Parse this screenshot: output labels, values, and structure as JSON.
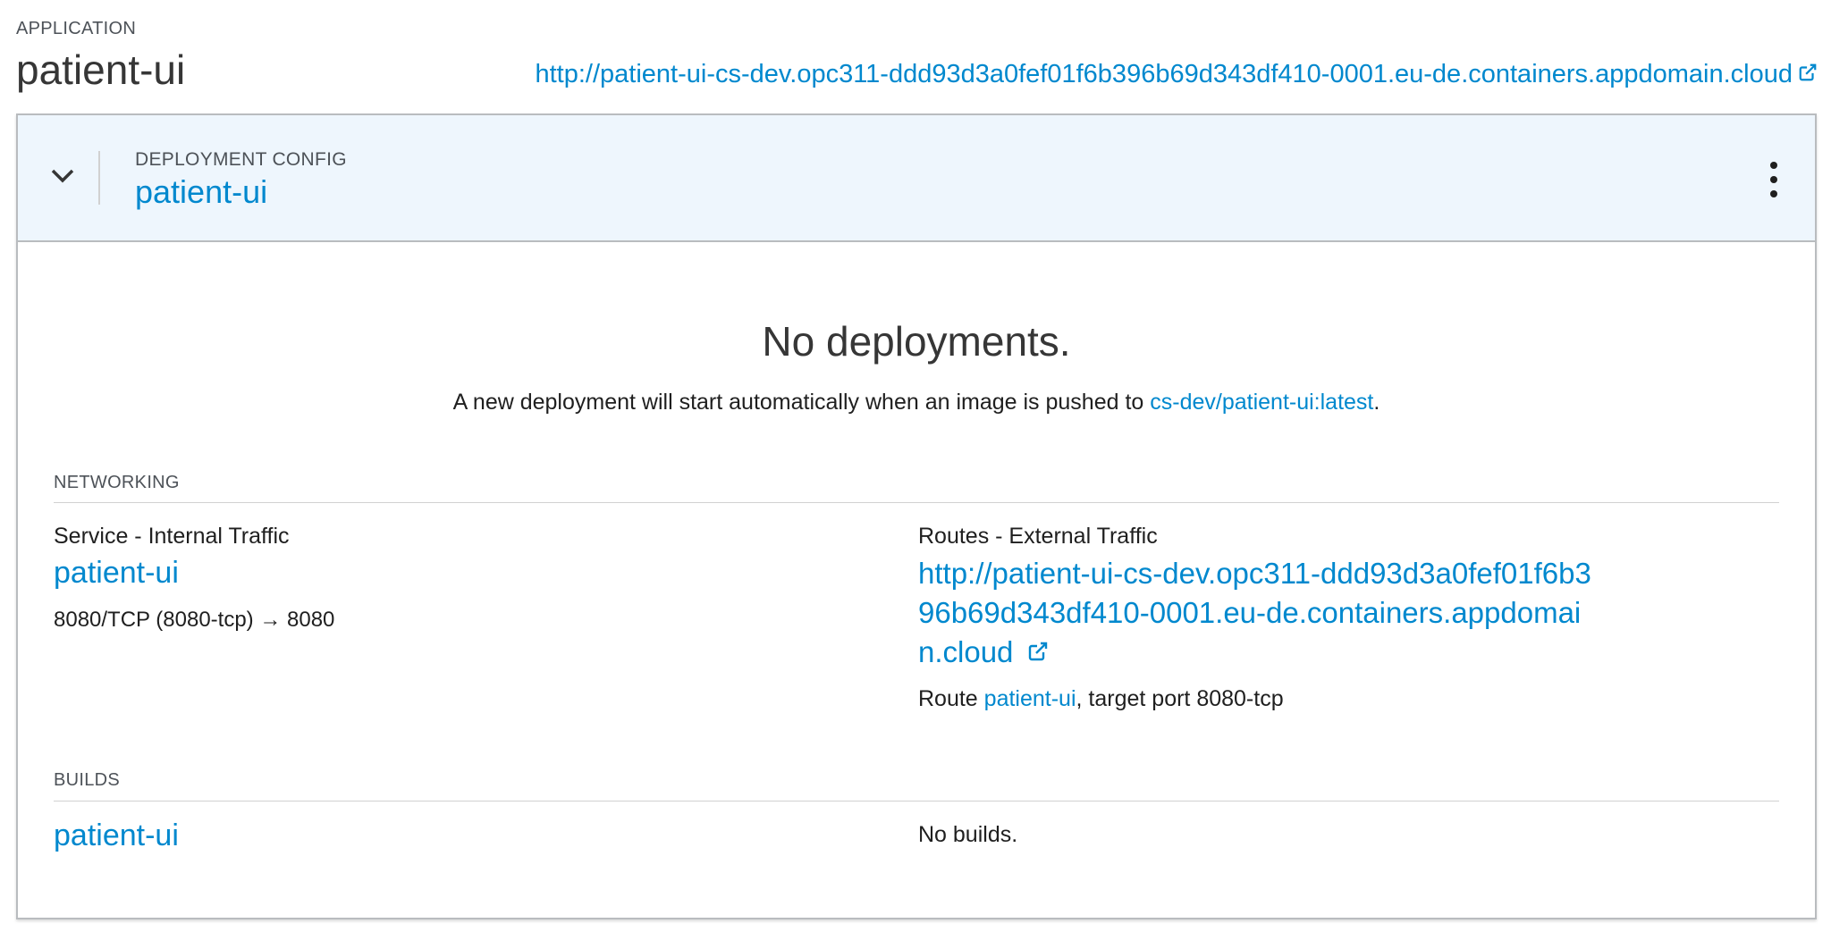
{
  "application": {
    "section_label": "APPLICATION",
    "name": "patient-ui",
    "route_url": "http://patient-ui-cs-dev.opc311-ddd93d3a0fef01f6b396b69d343df410-0001.eu-de.containers.appdomain.cloud"
  },
  "deployment_config": {
    "label": "DEPLOYMENT CONFIG",
    "name": "patient-ui"
  },
  "empty_state": {
    "title": "No deployments.",
    "text_before": "A new deployment will start automatically when an image is pushed to ",
    "image_link": "cs-dev/patient-ui:latest",
    "text_after": "."
  },
  "networking": {
    "label": "NETWORKING",
    "service": {
      "label": "Service - Internal Traffic",
      "name": "patient-ui",
      "ports": "8080/TCP (8080-tcp) → 8080"
    },
    "routes": {
      "label": "Routes - External Traffic",
      "url": "http://patient-ui-cs-dev.opc311-ddd93d3a0fef01f6b396b69d343df410-0001.eu-de.containers.appdomain.cloud",
      "route_prefix": "Route ",
      "route_name": "patient-ui",
      "route_suffix": ", target port 8080-tcp"
    }
  },
  "builds": {
    "label": "BUILDS",
    "name": "patient-ui",
    "status": "No builds."
  },
  "icons": {
    "toggle": "chevron-down-icon",
    "external": "external-link-icon",
    "menu": "kebab-menu-icon"
  },
  "colors": {
    "link": "#0088ce",
    "header_bg": "#eef6fd",
    "border": "#b9bcbf"
  }
}
